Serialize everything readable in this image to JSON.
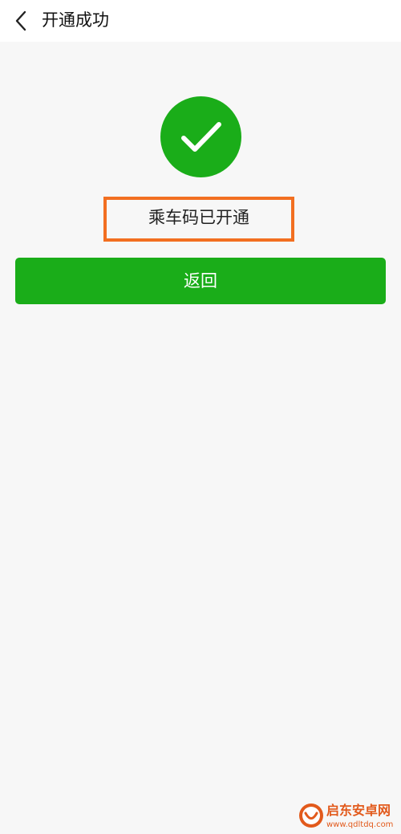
{
  "header": {
    "title": "开通成功"
  },
  "result": {
    "message": "乘车码已开通",
    "status_color": "#1aad19",
    "highlight_color": "#f26f21"
  },
  "actions": {
    "return_label": "返回"
  },
  "watermark": {
    "name": "启东安卓网",
    "url": "www.qdltdq.com"
  }
}
